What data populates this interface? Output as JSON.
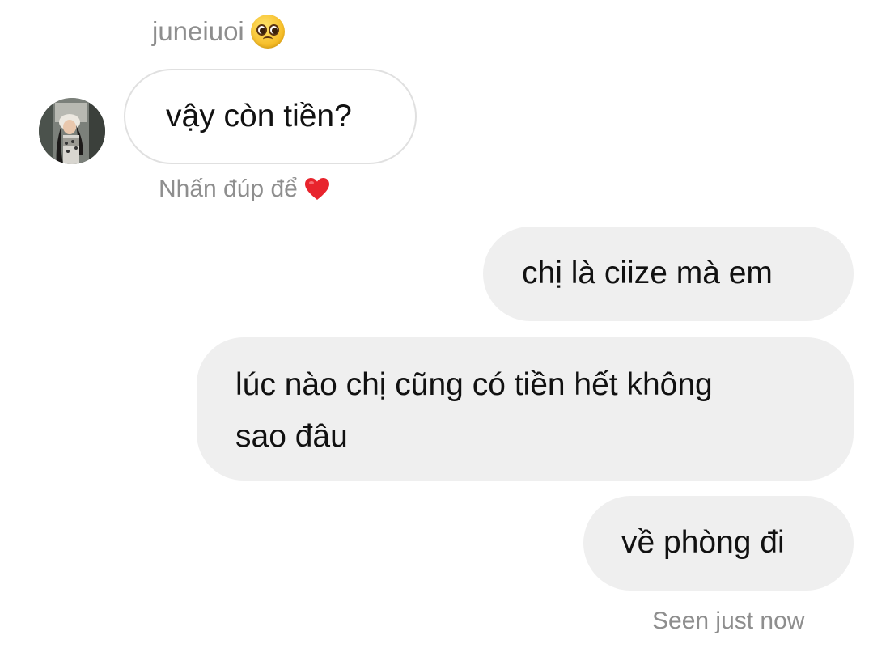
{
  "thread": {
    "sender_name": "juneiuoi",
    "sender_emoji": "🥺",
    "incoming_message": "vậy còn tiền?",
    "reaction_hint": "Nhấn đúp để",
    "reaction_icon": "heart-icon",
    "outgoing_messages": [
      {
        "lines": [
          "chị là ciize mà em"
        ]
      },
      {
        "lines": [
          "lúc nào chị cũng có tiền hết không",
          "sao đâu"
        ]
      },
      {
        "lines": [
          "về phòng đi"
        ]
      }
    ],
    "status": "Seen just now"
  },
  "colors": {
    "outgoing_bubble": "#efefef",
    "incoming_bubble_border": "#e0e0e0",
    "meta_text": "#8e8e8e",
    "heart": "#e8242d"
  }
}
